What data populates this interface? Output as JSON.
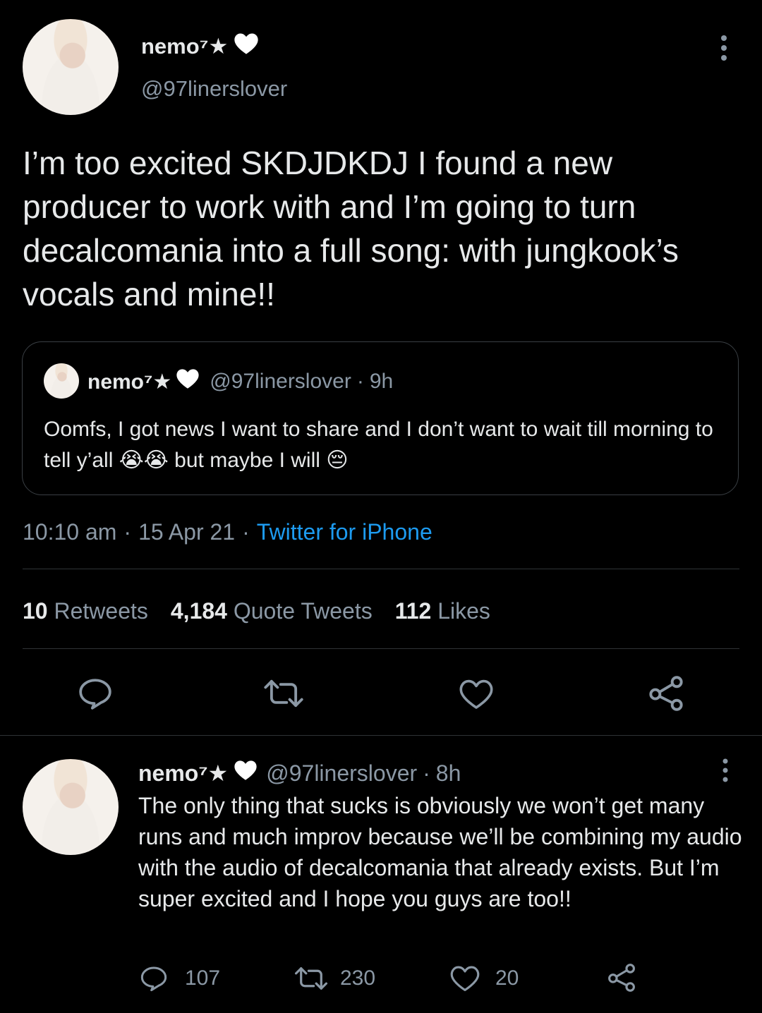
{
  "main_tweet": {
    "display_name": "nemo⁷★",
    "handle": "@97linerslover",
    "text": "I’m too excited SKDJDKDJ I found a new producer to work with and I’m going to turn decalcomania into a full song: with jungkook’s vocals and mine!!",
    "quoted": {
      "display_name": "nemo⁷★",
      "handle": "@97linerslover",
      "sep": "·",
      "time": "9h",
      "text_part1": "Oomfs, I got news I want to share and I don’t want to wait till morning to tell y’all",
      "emoji1": "😭😭",
      "text_part2": "but maybe I will",
      "emoji2": "😔"
    },
    "time": "10:10 am",
    "sep1": "·",
    "date": "15 Apr 21",
    "sep2": "·",
    "source": "Twitter for iPhone",
    "stats": {
      "retweets_count": "10",
      "retweets_label": "Retweets",
      "quotes_count": "4,184",
      "quotes_label": "Quote Tweets",
      "likes_count": "112",
      "likes_label": "Likes"
    }
  },
  "reply_tweet": {
    "display_name": "nemo⁷★",
    "handle": "@97linerslover",
    "sep": "·",
    "time": "8h",
    "text": "The only thing that sucks is obviously we won’t get many runs and much improv because we’ll be combining my audio with the audio of decalcomania that already exists. But I’m super excited and I hope you guys are too!!",
    "replies": "107",
    "retweets": "230",
    "likes": "20"
  },
  "colors": {
    "background": "#000000",
    "text": "#e7e9ea",
    "muted": "#8b98a5",
    "accent": "#1d9bf0",
    "divider": "#2f3336"
  }
}
